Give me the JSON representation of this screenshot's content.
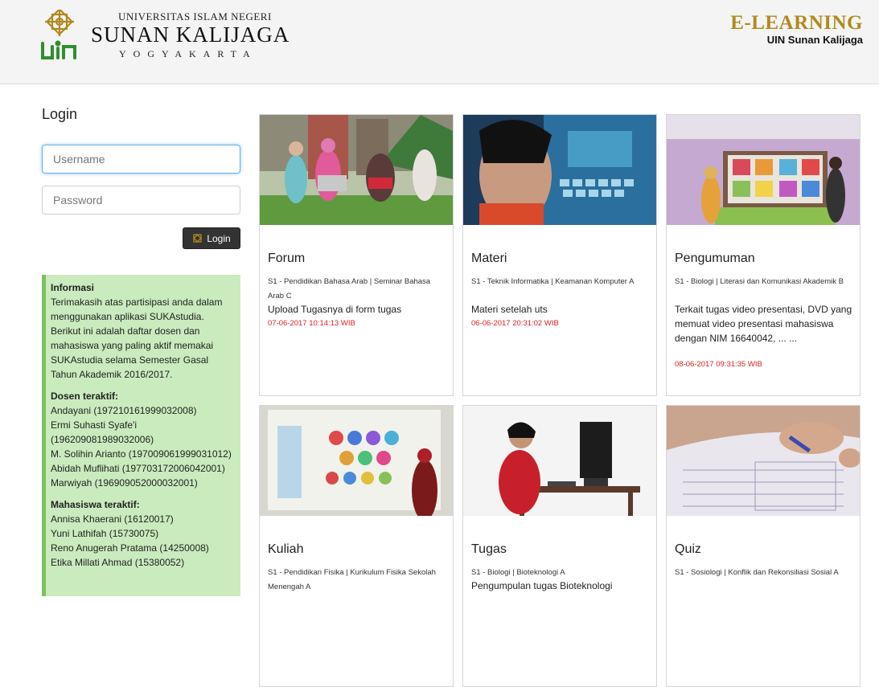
{
  "header": {
    "uni_top": "UNIVERSITAS ISLAM NEGERI",
    "uni_main": "SUNAN KALIJAGA",
    "uni_city": "YOGYAKARTA",
    "title": "E-LEARNING",
    "subtitle": "UIN Sunan Kalijaga"
  },
  "login": {
    "title": "Login",
    "username_placeholder": "Username",
    "password_placeholder": "Password",
    "button_label": "Login"
  },
  "info": {
    "heading": "Informasi",
    "text": "Terimakasih atas partisipasi anda dalam menggunakan aplikasi SUKAstudia. Berikut ini adalah daftar dosen dan mahasiswa yang paling aktif memakai SUKAstudia selama Semester Gasal Tahun Akademik 2016/2017.",
    "dosen_heading": "Dosen teraktif:",
    "dosen": [
      "Andayani (197210161999032008)",
      "Ermi Suhasti Syafe'i (196209081989032006)",
      "M. Solihin Arianto (197009061999031012)",
      "Abidah Muflihati (197703172006042001)",
      "Marwiyah (196909052000032001)"
    ],
    "mahasiswa_heading": "Mahasiswa teraktif:",
    "mahasiswa": [
      "Annisa Khaerani (16120017)",
      "Yuni Lathifah (15730075)",
      "Reno Anugerah Pratama (14250008)",
      "Etika Millati Ahmad (15380052)"
    ]
  },
  "cards": [
    {
      "title": "Forum",
      "meta": "S1 - Pendidikan Bahasa Arab | Seminar Bahasa Arab C",
      "desc": "Upload Tugasnya di form tugas",
      "date": "07-06-2017 10:14:13 WIB"
    },
    {
      "title": "Materi",
      "meta": "S1 - Teknik Informatika | Keamanan Komputer A",
      "desc": "Materi setelah uts",
      "date": "06-06-2017 20:31:02 WIB"
    },
    {
      "title": "Pengumuman",
      "meta": "S1 - Biologi | Literasi dan Komunikasi Akademik B",
      "desc": "Terkait tugas video presentasi, DVD yang memuat video presentasi mahasiswa dengan NIM 16640042, ... ...",
      "date": "08-06-2017 09:31:35 WIB"
    },
    {
      "title": "Kuliah",
      "meta": "S1 - Pendidikan Fisika | Kurikulum Fisika Sekolah Menengah A",
      "desc": "",
      "date": ""
    },
    {
      "title": "Tugas",
      "meta": "S1 - Biologi | Bioteknologi A",
      "desc": "Pengumpulan tugas Bioteknologi",
      "date": ""
    },
    {
      "title": "Quiz",
      "meta": "S1 - Sosiologi | Konflik dan Rekonsiliasi Sosial A",
      "desc": "",
      "date": ""
    }
  ]
}
